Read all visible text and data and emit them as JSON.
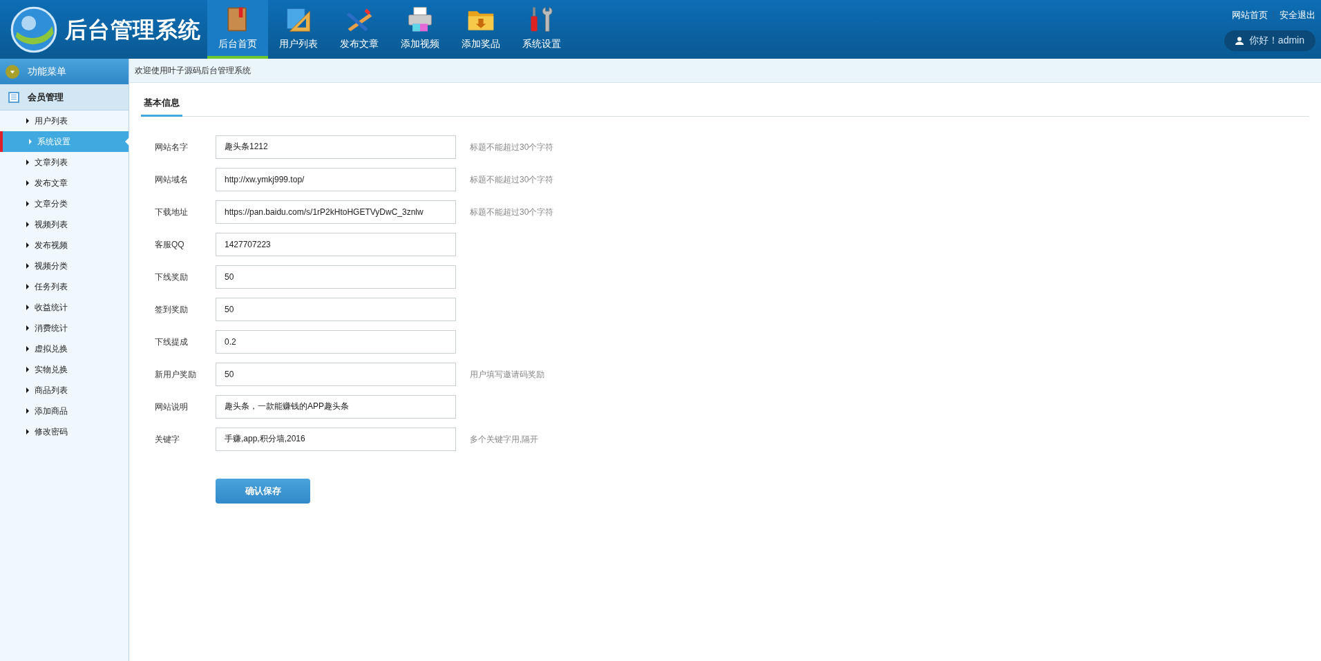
{
  "header": {
    "title": "后台管理系统",
    "nav": [
      {
        "label": "后台首页",
        "selected": true,
        "kind": "book"
      },
      {
        "label": "用户列表",
        "selected": false,
        "kind": "ruler"
      },
      {
        "label": "发布文章",
        "selected": false,
        "kind": "pencil"
      },
      {
        "label": "添加视频",
        "selected": false,
        "kind": "printer"
      },
      {
        "label": "添加奖品",
        "selected": false,
        "kind": "folder"
      },
      {
        "label": "系统设置",
        "selected": false,
        "kind": "tools"
      }
    ],
    "links": [
      "网站首页",
      "安全退出"
    ],
    "greeting": "你好！admin"
  },
  "sidebar": {
    "title": "功能菜单",
    "group": "会员管理",
    "items": [
      {
        "label": "用户列表",
        "selected": false
      },
      {
        "label": "系统设置",
        "selected": true
      },
      {
        "label": "文章列表",
        "selected": false
      },
      {
        "label": "发布文章",
        "selected": false
      },
      {
        "label": "文章分类",
        "selected": false
      },
      {
        "label": "视频列表",
        "selected": false
      },
      {
        "label": "发布视频",
        "selected": false
      },
      {
        "label": "视频分类",
        "selected": false
      },
      {
        "label": "任务列表",
        "selected": false
      },
      {
        "label": "收益统计",
        "selected": false
      },
      {
        "label": "消费统计",
        "selected": false
      },
      {
        "label": "虚拟兑换",
        "selected": false
      },
      {
        "label": "实物兑换",
        "selected": false
      },
      {
        "label": "商品列表",
        "selected": false
      },
      {
        "label": "添加商品",
        "selected": false
      },
      {
        "label": "修改密码",
        "selected": false
      }
    ]
  },
  "breadcrumb": "欢迎使用叶子源码后台管理系统",
  "tab": "基本信息",
  "form": {
    "fields": [
      {
        "label": "网站名字",
        "value": "趣头条1212",
        "hint": "标题不能超过30个字符"
      },
      {
        "label": "网站域名",
        "value": "http://xw.ymkj999.top/",
        "hint": "标题不能超过30个字符"
      },
      {
        "label": "下载地址",
        "value": "https://pan.baidu.com/s/1rP2kHtoHGETVyDwC_3znlw",
        "hint": "标题不能超过30个字符"
      },
      {
        "label": "客服QQ",
        "value": "1427707223"
      },
      {
        "label": "下线奖励",
        "value": "50"
      },
      {
        "label": "签到奖励",
        "value": "50"
      },
      {
        "label": "下线提成",
        "value": "0.2"
      },
      {
        "label": "新用户奖励",
        "value": "50",
        "hint": "用户填写邀请码奖励"
      },
      {
        "label": "网站说明",
        "value": "趣头条，一款能赚钱的APP趣头条"
      },
      {
        "label": "关键字",
        "value": "手赚,app,积分墙,2016",
        "hint": "多个关键字用,隔开"
      }
    ],
    "submit": "确认保存"
  }
}
